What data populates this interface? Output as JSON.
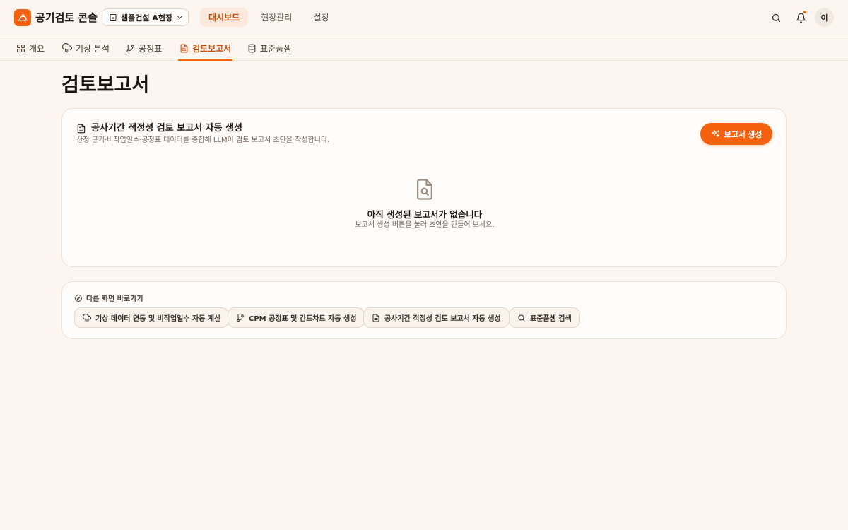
{
  "header": {
    "app_title": "공기검토 콘솔",
    "site_select_value": "샘플건설 A현장",
    "nav": [
      {
        "label": "대시보드",
        "active": true
      },
      {
        "label": "현장관리",
        "active": false
      },
      {
        "label": "설정",
        "active": false
      }
    ],
    "avatar_initial": "이",
    "has_notification": true
  },
  "subtabs": [
    {
      "label": "개요",
      "icon": "grid-icon"
    },
    {
      "label": "기상 분석",
      "icon": "cloud-rain-icon"
    },
    {
      "label": "공정표",
      "icon": "git-branch-icon"
    },
    {
      "label": "검토보고서",
      "icon": "document-icon",
      "active": true
    },
    {
      "label": "표준품셈",
      "icon": "database-icon"
    }
  ],
  "page": {
    "title": "검토보고서"
  },
  "report_card": {
    "title": "공사기간 적정성 검토 보고서 자동 생성",
    "description": "산정 근거·비작업일수·공정표 데이터를 종합해 LLM이 검토 보고서 초안을 작성합니다.",
    "generate_button": "보고서 생성",
    "empty_title": "아직 생성된 보고서가 없습니다",
    "empty_desc": "보고서 생성 버튼을 눌러 초안을 만들어 보세요."
  },
  "shortcuts": {
    "title": "다른 화면 바로가기",
    "items": [
      {
        "label": "기상 데이터 연동 및 비작업일수 자동 계산",
        "icon": "cloud-rain-icon"
      },
      {
        "label": "CPM 공정표 및 간트차트 자동 생성",
        "icon": "git-branch-icon"
      },
      {
        "label": "공사기간 적정성 검토 보고서 자동 생성",
        "icon": "document-icon"
      },
      {
        "label": "표준품셈 검색",
        "icon": "search-icon"
      }
    ]
  },
  "colors": {
    "accent": "#f5620f",
    "accent_text": "#c54d0a",
    "background": "#fdf6f0",
    "card": "#fffdfb"
  }
}
